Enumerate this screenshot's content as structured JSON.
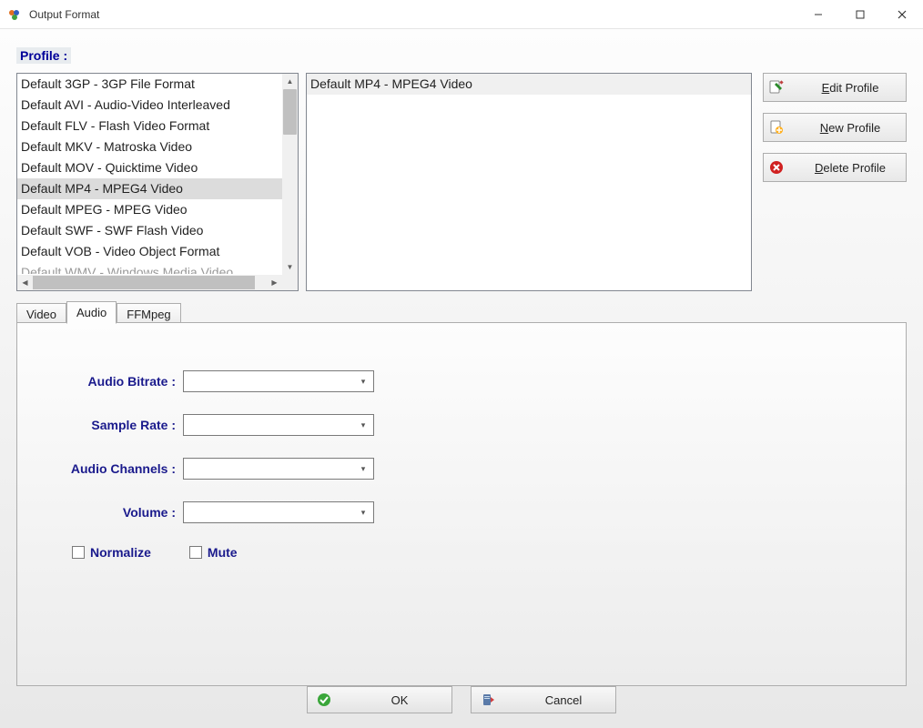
{
  "window": {
    "title": "Output Format"
  },
  "profile": {
    "label": "Profile :",
    "items": [
      "Default 3GP - 3GP File Format",
      "Default AVI - Audio-Video Interleaved",
      "Default FLV - Flash Video Format",
      "Default MKV - Matroska Video",
      "Default MOV - Quicktime Video",
      "Default MP4 - MPEG4 Video",
      "Default MPEG - MPEG Video",
      "Default SWF - SWF Flash Video",
      "Default VOB - Video Object Format",
      "Default WMV - Windows Media Video"
    ],
    "selected_index": 5,
    "detail_selected": "Default MP4 - MPEG4 Video"
  },
  "actions": {
    "edit": "Edit Profile",
    "new": "New Profile",
    "delete": "Delete Profile"
  },
  "tabs": {
    "video": "Video",
    "audio": "Audio",
    "ffmpeg": "FFMpeg",
    "active": "audio"
  },
  "audio_panel": {
    "bitrate_label": "Audio Bitrate :",
    "bitrate_value": "",
    "samplerate_label": "Sample Rate :",
    "samplerate_value": "",
    "channels_label": "Audio Channels :",
    "channels_value": "",
    "volume_label": "Volume :",
    "volume_value": "",
    "normalize_label": "Normalize",
    "normalize_checked": false,
    "mute_label": "Mute",
    "mute_checked": false
  },
  "bottom": {
    "ok": "OK",
    "cancel": "Cancel"
  }
}
